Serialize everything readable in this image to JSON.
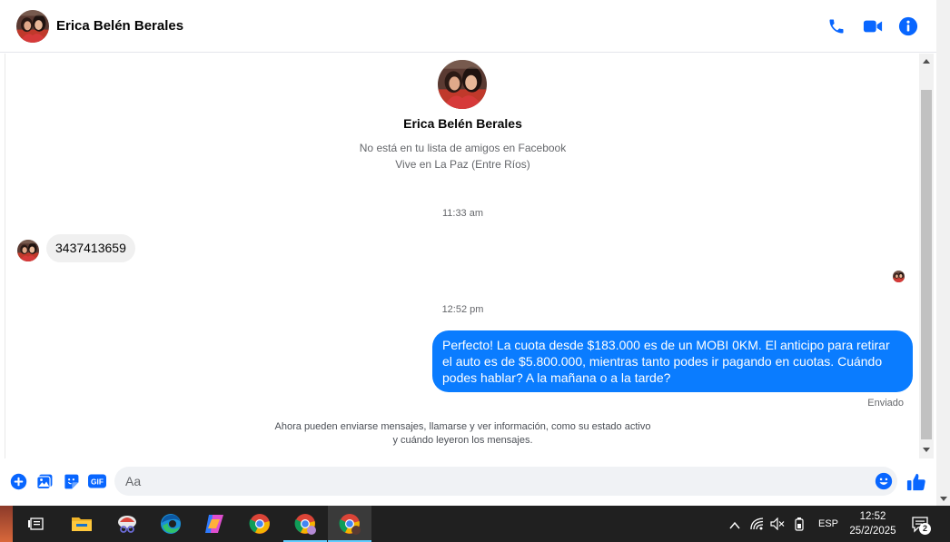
{
  "header": {
    "contact_name": "Erica Belén Berales",
    "icons": [
      "phone-icon",
      "video-call-icon",
      "info-icon"
    ]
  },
  "profile": {
    "name": "Erica Belén Berales",
    "friend_status": "No está en tu lista de amigos en Facebook",
    "location": "Vive en La Paz (Entre Ríos)"
  },
  "messages": {
    "time_1": "11:33 am",
    "incoming_1": "3437413659",
    "time_2": "12:52 pm",
    "outgoing_1": "Perfecto! La cuota desde $183.000 es de un MOBI 0KM. El anticipo para retirar el auto es de $5.800.000, mientras tanto podes ir pagando en cuotas. Cuándo podes hablar? A la mañana o a la tarde?",
    "status": "Enviado",
    "notice_line_1": "Ahora pueden enviarse mensajes, llamarse y ver información, como su estado activo",
    "notice_line_2": "y cuándo leyeron los mensajes."
  },
  "composer": {
    "placeholder": "Aa",
    "gif_label": "GIF",
    "icons": [
      "add-icon",
      "photo-icon",
      "sticker-icon",
      "gif-icon",
      "emoji-icon",
      "like-icon"
    ]
  },
  "taskbar": {
    "apps": [
      "task-view-icon",
      "file-explorer-icon",
      "snipping-tool-icon",
      "edge-icon",
      "copilot-icon",
      "chrome-icon",
      "chrome-profile-icon",
      "chrome-profile-2-icon"
    ],
    "language": "ESP",
    "time": "12:52",
    "date": "25/2/2025",
    "notifications": "2"
  },
  "colors": {
    "messenger_blue": "#0a7cff",
    "icon_blue": "#0866ff",
    "taskbar": "#202020"
  }
}
